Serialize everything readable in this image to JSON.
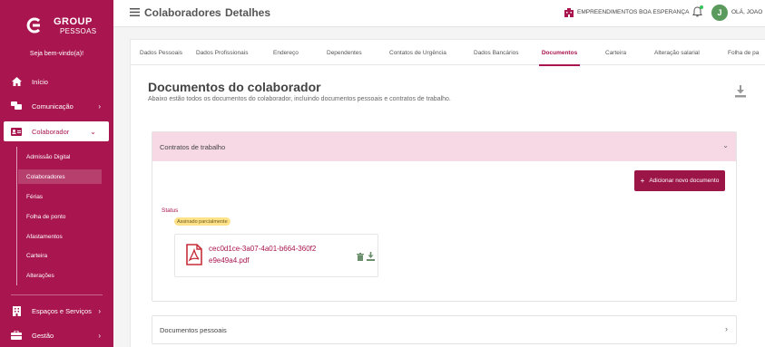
{
  "brand": {
    "logo_group": "GROUP",
    "logo_pessoas": "PESSOAS",
    "welcome": "Seja bem-vindo(a)!"
  },
  "sidebar": {
    "items": [
      {
        "label": "Início",
        "icon": "home-icon"
      },
      {
        "label": "Comunicação",
        "icon": "chat-icon"
      },
      {
        "label": "Colaborador",
        "icon": "id-card-icon"
      },
      {
        "label": "Espaços e Serviços",
        "icon": "building-icon"
      },
      {
        "label": "Gestão",
        "icon": "briefcase-icon"
      }
    ],
    "submenu": [
      {
        "label": "Admissão Digital"
      },
      {
        "label": "Colaboradores"
      },
      {
        "label": "Férias"
      },
      {
        "label": "Folha de ponto"
      },
      {
        "label": "Afastamentos"
      },
      {
        "label": "Carteira"
      },
      {
        "label": "Alterações"
      }
    ]
  },
  "topbar": {
    "title": "Colaboradores",
    "separator": "›",
    "detail": "Detalhes",
    "company": "EMPREENDIMENTOS BOA ESPERANÇA",
    "avatar_initial": "J",
    "greeting": "OLÁ, JOAO"
  },
  "tabs": [
    "Dados Pessoais",
    "Dados Profissionais",
    "Endereço",
    "Dependentes",
    "Contatos de Urgência",
    "Dados Bancários",
    "Documentos",
    "Carteira",
    "Alteração salarial",
    "Folha de pa"
  ],
  "active_tab": "Documentos",
  "page": {
    "title": "Documentos do colaborador",
    "subtitle": "Abaixo estão todos os documentos do colaborador, incluindo documentos pessoais e contratos de trabalho."
  },
  "contratos": {
    "title": "Contratos de trabalho",
    "add_button": "Adicionar novo documento",
    "status_label": "Status",
    "status_value": "Assinado parcialmente",
    "file_name": "cec0d1ce-3a07-4a01-b664-360f2e9e49a4.pdf"
  },
  "pessoais": {
    "title": "Documentos pessoais"
  },
  "colors": {
    "brand": "#a8154f",
    "accordion_header": "#f6d9e4",
    "badge": "#fde28a"
  }
}
